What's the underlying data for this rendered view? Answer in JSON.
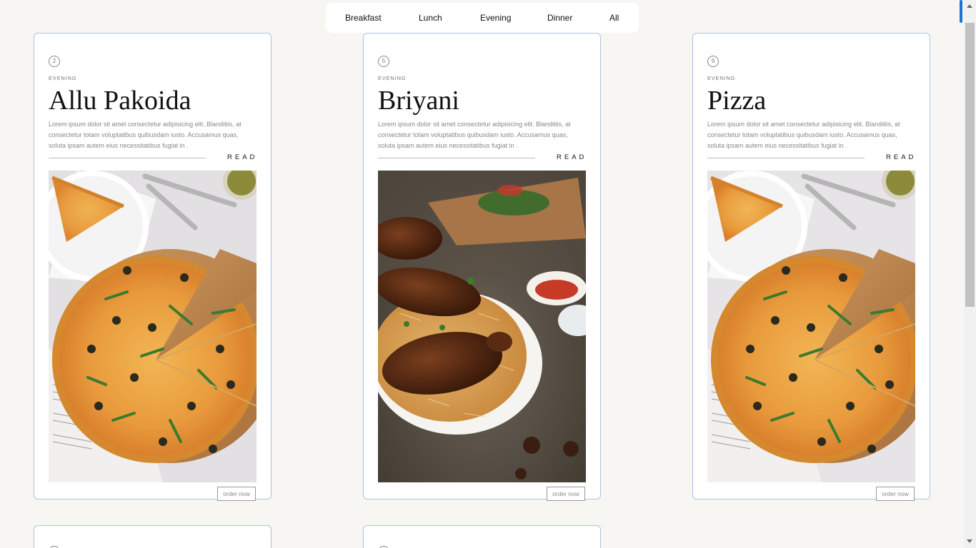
{
  "nav": {
    "items": [
      "Breakfast",
      "Lunch",
      "Evening",
      "Dinner",
      "All"
    ]
  },
  "cards": [
    {
      "number": "2",
      "category": "EVENING",
      "title": "Allu Pakoida",
      "description": "Lorem ipsum dolor sit amet consectetur adipisicing elit. Blanditiis, at consectetur totam voluptatibus quibusdam iusto. Accusamus quas, soluta ipsam autem eius necessitatibus fugiat in .",
      "read_label": "READ",
      "image": "pizza-photo",
      "order_label": "order now"
    },
    {
      "number": "5",
      "category": "EVENING",
      "title": "Briyani",
      "description": "Lorem ipsum dolor sit amet consectetur adipisicing elit. Blanditiis, at consectetur totam voluptatibus quibusdam iusto. Accusamus quas, soluta ipsam autem eius necessitatibus fugiat in .",
      "read_label": "READ",
      "image": "biryani-photo",
      "order_label": "order now"
    },
    {
      "number": "9",
      "category": "EVENING",
      "title": "Pizza",
      "description": "Lorem ipsum dolor sit amet consectetur adipisicing elit. Blanditiis, at consectetur totam voluptatibus quibusdam iusto. Accusamus quas, soluta ipsam autem eius necessitatibus fugiat in .",
      "read_label": "READ",
      "image": "pizza-photo",
      "order_label": "order now"
    }
  ],
  "colors": {
    "background": "#f8f6f3",
    "card_border": "#a9c4e2",
    "text_dark": "#111111",
    "text_muted": "#888888"
  }
}
